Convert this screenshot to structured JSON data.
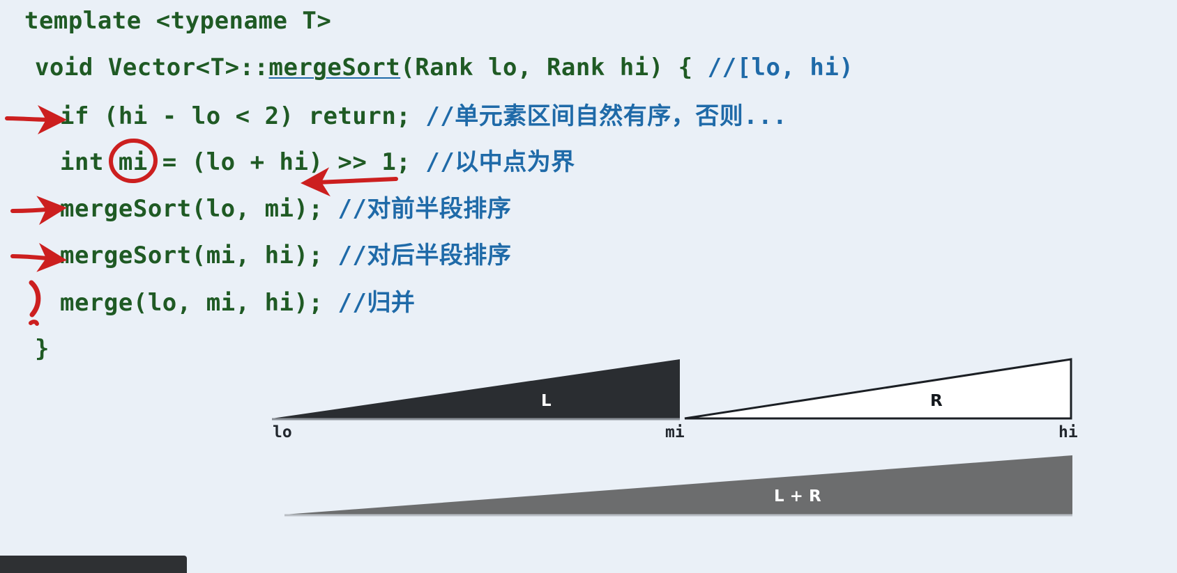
{
  "slide": {
    "background_color": "#eaf0f7",
    "code_color": "#1f5a24",
    "comment_color": "#1f6aa8",
    "annotation_color": "#cc1f1f"
  },
  "code": {
    "bullet_glyph": "❖",
    "lines": [
      {
        "id": "line-template",
        "has_bullet": true,
        "code": "template <typename T>",
        "comment": ""
      },
      {
        "id": "line-signature",
        "has_bullet": false,
        "code_pre": "void Vector<T>::",
        "code_fn": "mergeSort",
        "code_post": "(Rank lo, Rank hi) { ",
        "comment": "//[lo, hi)"
      },
      {
        "id": "line-basecase",
        "has_bullet": false,
        "code": "if (hi - lo < 2) return; ",
        "comment": "//单元素区间自然有序，否则..."
      },
      {
        "id": "line-midpoint",
        "has_bullet": false,
        "code": "int mi = (lo + hi) >> 1; ",
        "comment": "//以中点为界"
      },
      {
        "id": "line-recurse-left",
        "has_bullet": false,
        "code": "mergeSort(lo, mi); ",
        "comment": "//对前半段排序"
      },
      {
        "id": "line-recurse-right",
        "has_bullet": false,
        "code": "mergeSort(mi, hi); ",
        "comment": "//对后半段排序"
      },
      {
        "id": "line-merge",
        "has_bullet": false,
        "code": "merge(lo, mi, hi); ",
        "comment": "//归并"
      },
      {
        "id": "line-close-brace",
        "has_bullet": false,
        "code": "}",
        "comment": ""
      }
    ]
  },
  "annotations": {
    "arrow_basecase": "red-arrow-pointing-to-if-line",
    "circle_mi": "red-circle-around-mi",
    "underline_shift": "red-underline-under-shift-expression",
    "arrow_recurse_left": "red-arrow-pointing-to-mergesort-left",
    "arrow_recurse_right": "red-arrow-pointing-to-mergesort-right",
    "brace_merge": "red-paren-mark-left-of-merge"
  },
  "diagram": {
    "ticks": [
      {
        "id": "tick-lo",
        "label": "lo"
      },
      {
        "id": "tick-mi",
        "label": "mi"
      },
      {
        "id": "tick-hi",
        "label": "hi"
      }
    ],
    "shapes": [
      {
        "id": "triangle-left",
        "label": "L",
        "fill": "#2a2d31",
        "text_color": "#ffffff"
      },
      {
        "id": "triangle-right",
        "label": "R",
        "fill": "#ffffff",
        "text_color": "#14181d"
      },
      {
        "id": "triangle-merged",
        "label": "L + R",
        "fill": "#6c6d6e",
        "text_color": "#ffffff"
      }
    ]
  },
  "taskbar": {
    "present": true,
    "color": "#2e3033"
  }
}
